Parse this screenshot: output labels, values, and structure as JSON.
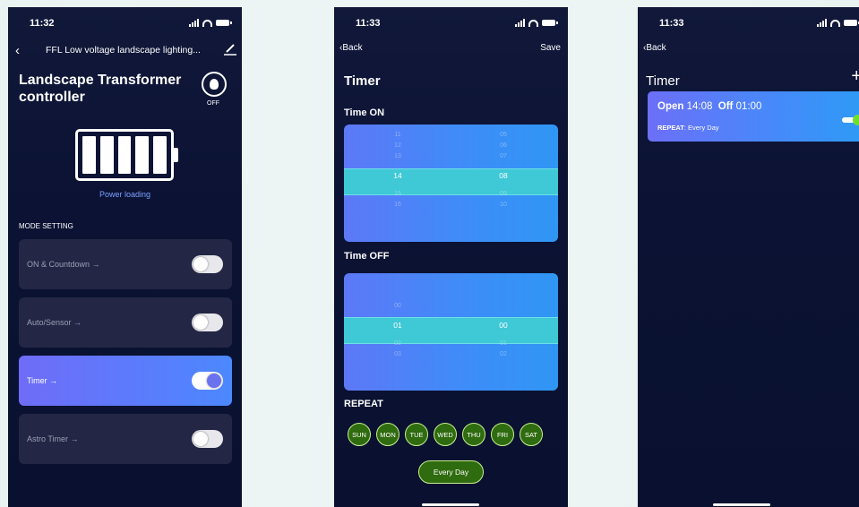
{
  "phone1": {
    "status_time": "11:32",
    "nav_title": "FFL Low voltage landscape lighting...",
    "title": "Landscape Transformer controller",
    "bulb_state": "OFF",
    "power_label": "Power loading",
    "section_label": "MODE SETTING",
    "modes": [
      {
        "label": "ON & Countdown  →",
        "enabled": false
      },
      {
        "label": "Auto/Sensor  →",
        "enabled": false
      },
      {
        "label": "Timer  →",
        "enabled": true
      },
      {
        "label": "Astro Timer  →",
        "enabled": false
      }
    ],
    "icons": [
      "back-chevron-icon",
      "edit-pen-icon",
      "bulb-icon",
      "battery-icon"
    ]
  },
  "phone2": {
    "status_time": "11:33",
    "back_label": "Back",
    "save_label": "Save",
    "title": "Timer",
    "time_on_label": "Time ON",
    "time_off_label": "Time OFF",
    "time_on_hours": [
      "11",
      "12",
      "13",
      "14",
      "15",
      "16"
    ],
    "time_on_minutes": [
      "05",
      "06",
      "07",
      "08",
      "09",
      "10"
    ],
    "time_on_selected": {
      "hour": "14",
      "minute": "08"
    },
    "time_off_hours": [
      "00",
      "01",
      "02",
      "03"
    ],
    "time_off_minutes": [
      "00",
      "01",
      "02"
    ],
    "time_off_selected": {
      "hour": "01",
      "minute": "00"
    },
    "repeat_label": "REPEAT",
    "days": [
      "SUN",
      "MON",
      "TUE",
      "WED",
      "THU",
      "FRI",
      "SAT"
    ],
    "every_day_label": "Every Day"
  },
  "phone3": {
    "status_time": "11:33",
    "back_label": "Back",
    "title": "Timer",
    "add_icon": "plus-icon",
    "entry": {
      "open_label": "Open",
      "open_time": "14:08",
      "off_label": "Off",
      "off_time": "01:00",
      "repeat_label": "REPEAT",
      "repeat_value": ": Every Day",
      "enabled": true
    }
  },
  "colors": {
    "background": "#0b1233",
    "accent_blue": "#4c88ff",
    "accent_purple": "#6f6cf8",
    "selection_band": "#3fc8d6",
    "day_green": "#2f6b0f",
    "toggle_on": "#6ee02c"
  }
}
